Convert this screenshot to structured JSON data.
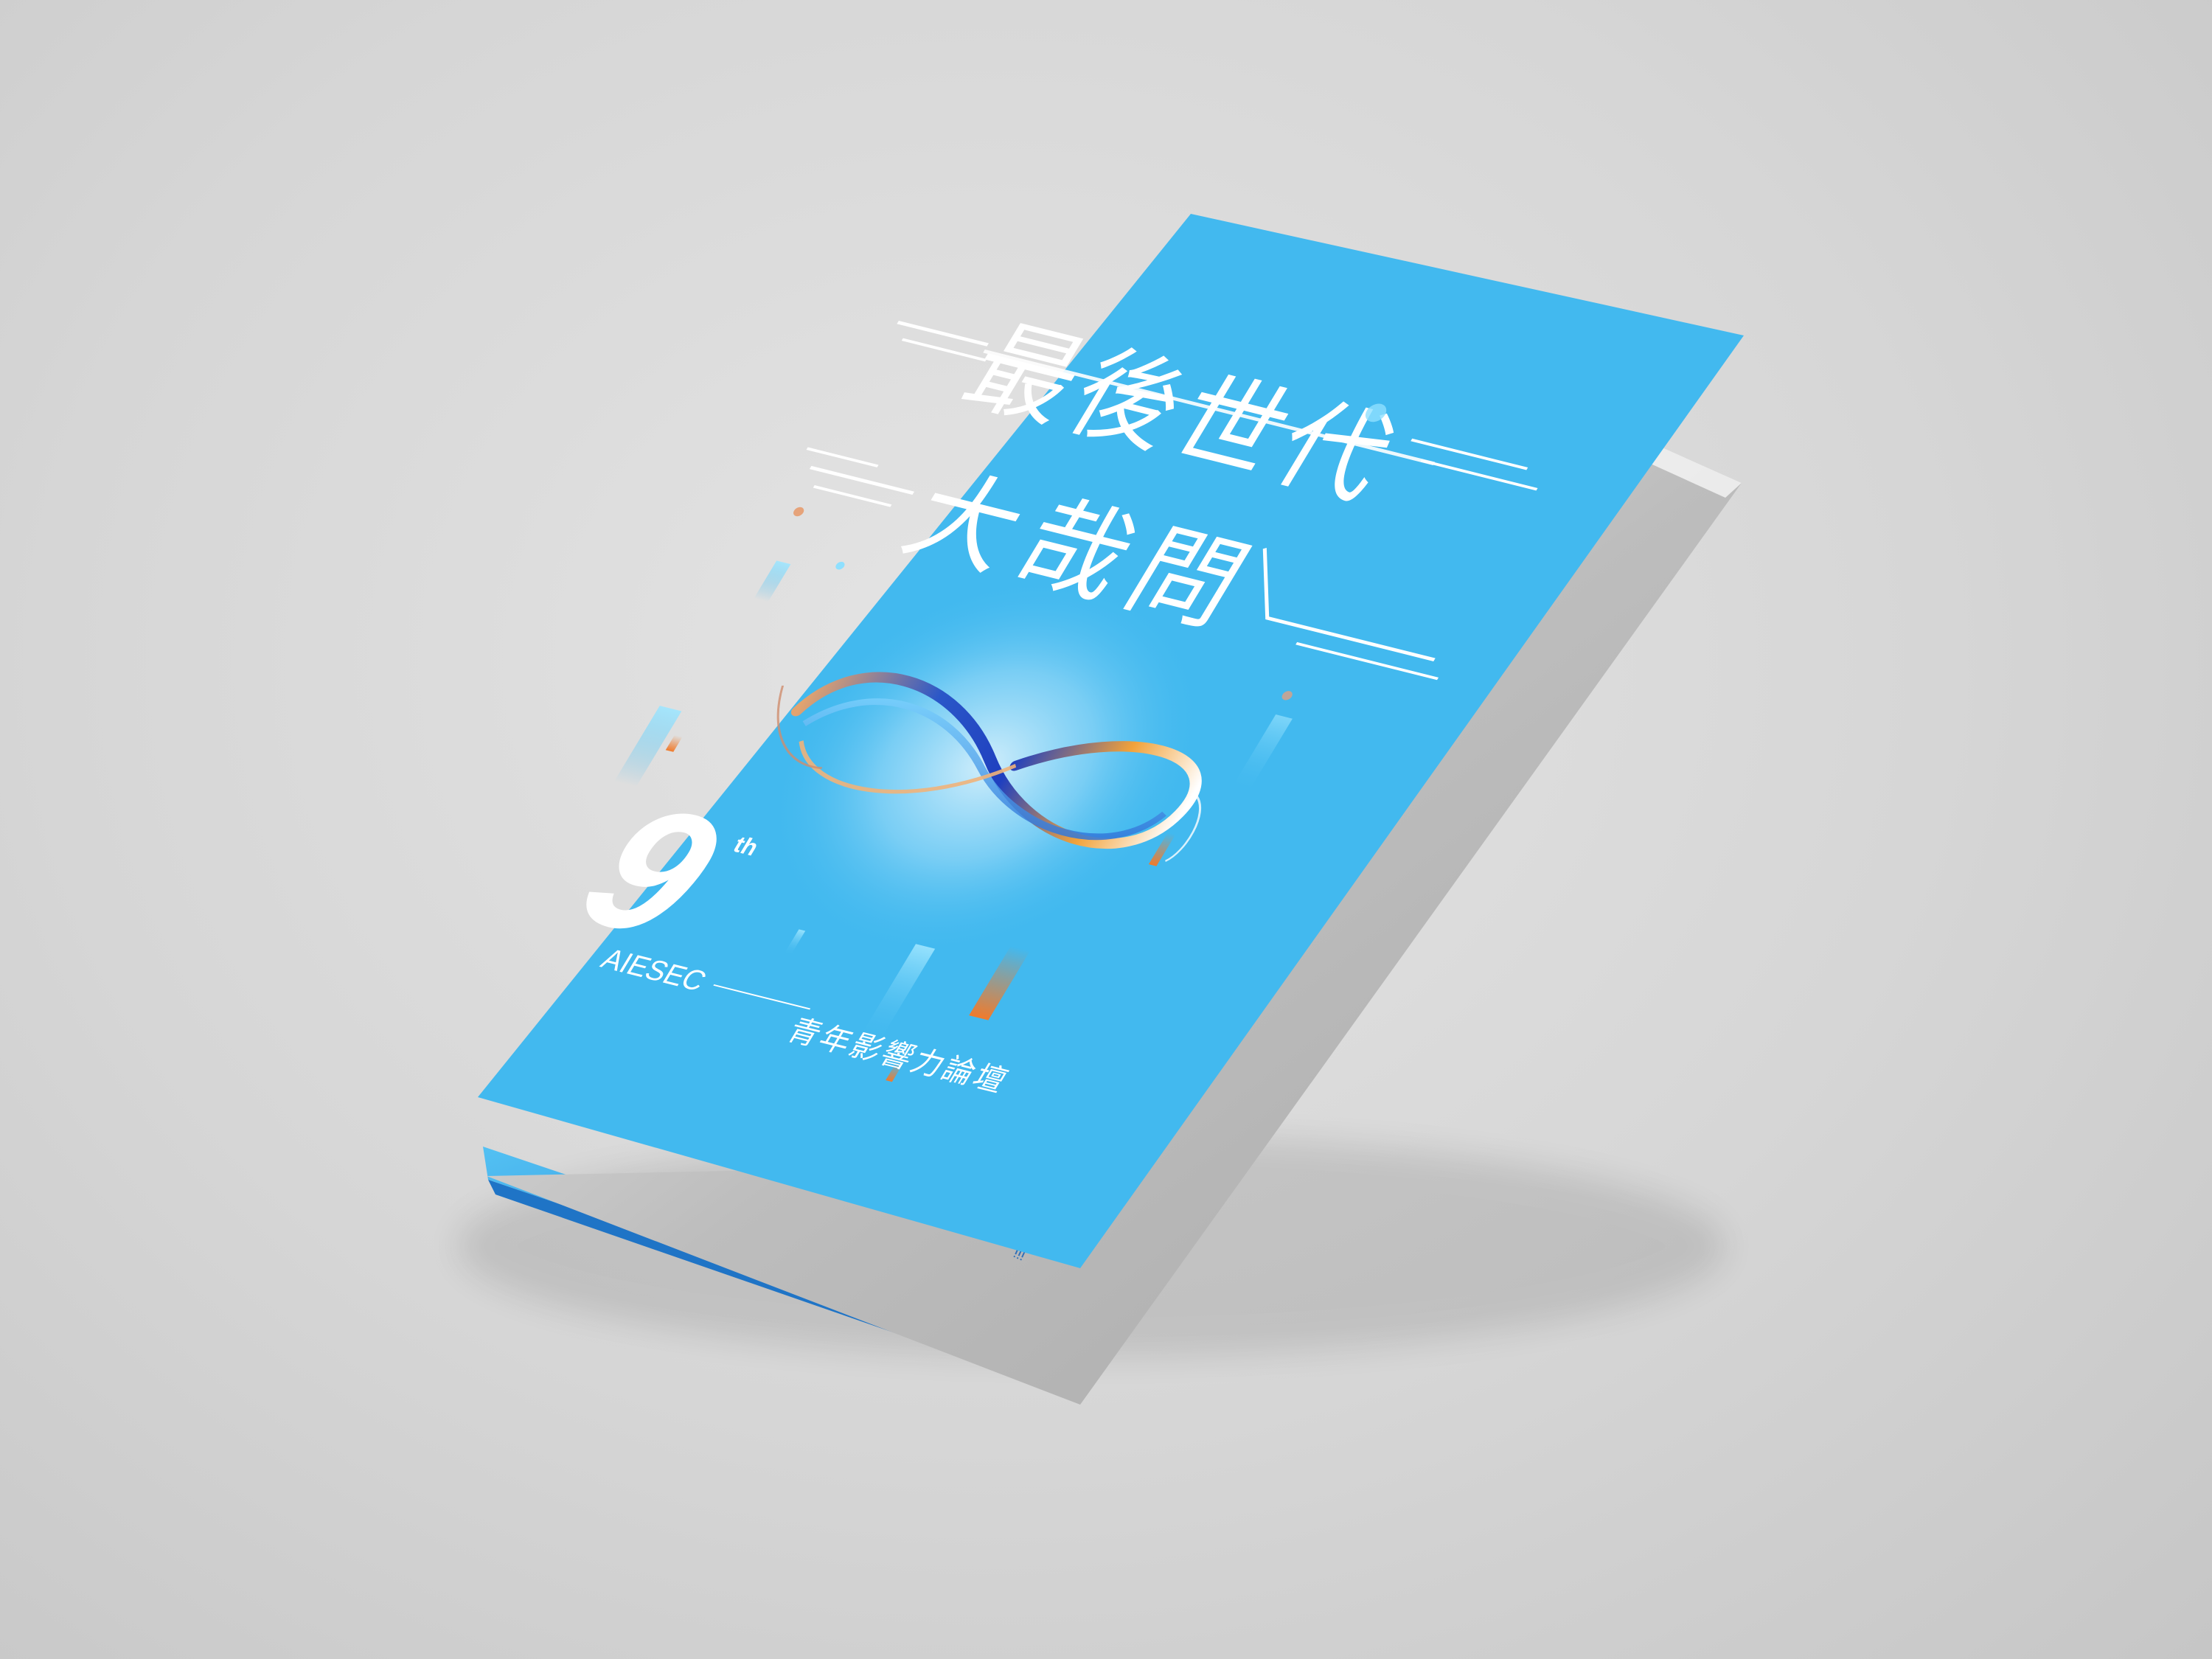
{
  "brochure": {
    "title_line_1": "最後世代",
    "title_line_2": "大哉問",
    "edition_number": "9",
    "edition_suffix": "th",
    "organization": "AIESEC",
    "event_name": "青年影響力論壇",
    "colors": {
      "cover": "#42b9ef",
      "inner_page": "#b8b8b8",
      "back_cover": "#2f8fd6",
      "accent_orange": "#f07b2c",
      "text": "#ffffff"
    },
    "icons": [
      "infinity-ribbon-logo"
    ]
  }
}
